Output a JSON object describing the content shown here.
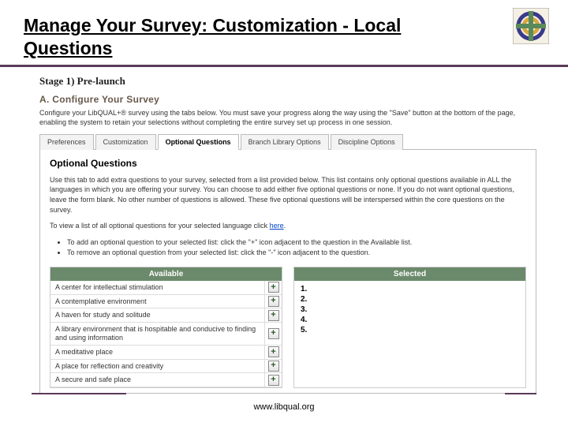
{
  "slide": {
    "title": "Manage Your Survey: Customization - Local Questions",
    "footer_url": "www.libqual.org"
  },
  "stage": {
    "label": "Stage 1) Pre-launch"
  },
  "section": {
    "title": "A. Configure Your Survey",
    "intro": "Configure your LibQUAL+® survey using the tabs below. You must save your progress along the way using the \"Save\" button at the bottom of the page, enabling the system to retain your selections without completing the entire survey set up process in one session."
  },
  "tabs": {
    "items": [
      {
        "label": "Preferences"
      },
      {
        "label": "Customization"
      },
      {
        "label": "Optional Questions"
      },
      {
        "label": "Branch Library Options"
      },
      {
        "label": "Discipline Options"
      }
    ],
    "active_index": 2
  },
  "panel": {
    "title": "Optional Questions",
    "p1": "Use this tab to add extra questions to your survey, selected from a list provided below. This list contains only optional questions available in ALL the languages in which you are offering your survey. You can choose to add either five optional questions or none. If you do not want optional questions, leave the form blank. No other number of questions is allowed. These five optional questions will be interspersed within the core questions on the survey.",
    "p2_prefix": "To view a list of all optional questions for your selected language click ",
    "p2_link": "here",
    "p2_suffix": ".",
    "bullets": [
      "To add an optional question to your selected list: click the \"+\" icon adjacent to the question in the Available list.",
      "To remove an optional question from your selected list: click the \"-\" icon adjacent to the question."
    ]
  },
  "dual": {
    "available_header": "Available",
    "selected_header": "Selected",
    "available": [
      "A center for intellectual stimulation",
      "A contemplative environment",
      "A haven for study and solitude",
      "A library environment that is hospitable and conducive to finding and using information",
      "A meditative place",
      "A place for reflection and creativity",
      "A secure and safe place"
    ],
    "selected_slots": [
      "1.",
      "2.",
      "3.",
      "4.",
      "5."
    ],
    "plus_glyph": "+"
  }
}
